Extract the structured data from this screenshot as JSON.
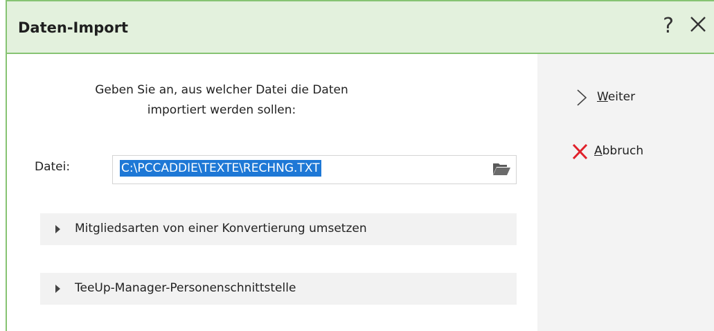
{
  "window": {
    "title": "Daten-Import",
    "help_label": "?",
    "colors": {
      "title_bg": "#e3f1dd",
      "border": "#86c372",
      "selection": "#1e78d6",
      "cancel_red": "#e0202a"
    }
  },
  "main": {
    "instruction_line1": "Geben Sie an, aus welcher Datei die Daten",
    "instruction_line2": "importiert werden sollen:",
    "file_label": "Datei:",
    "file_value": "C:\\PCCADDIE\\TEXTE\\RECHNG.TXT",
    "browse_icon": "folder-open-icon",
    "expanders": [
      {
        "label": "Mitgliedsarten von einer Konvertierung umsetzen",
        "icon": "chevron-right-icon"
      },
      {
        "label": "TeeUp-Manager-Personenschnittstelle",
        "icon": "chevron-right-icon"
      }
    ]
  },
  "actions": {
    "next": {
      "accel": "W",
      "rest": "eiter",
      "icon": "chevron-right-icon"
    },
    "cancel": {
      "accel": "A",
      "rest": "bbruch",
      "icon": "cancel-x-icon"
    }
  }
}
